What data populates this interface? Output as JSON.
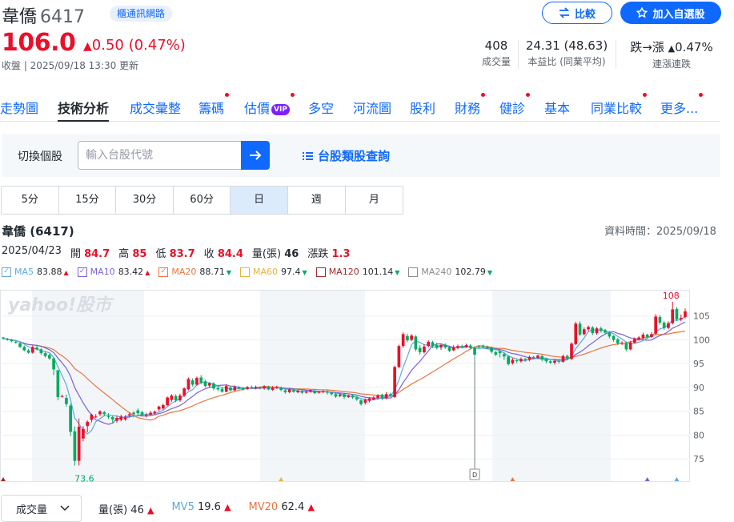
{
  "stock": {
    "name": "韋僑",
    "code": "6417",
    "category": "櫃通訊網路",
    "price": "106.0",
    "change": "0.50 (0.47%)",
    "status": "收盤 | 2025/09/18 13:30 更新"
  },
  "actions": {
    "compare": "比較",
    "watchlist": "加入自選股"
  },
  "stats": [
    {
      "value": "408",
      "label": "成交量"
    },
    {
      "value": "24.31 (48.63)",
      "label": "本益比 (同業平均)"
    },
    {
      "value_prefix": "跌→漲",
      "value_change": "0.47%",
      "label": "連漲連跌"
    }
  ],
  "nav": [
    {
      "label": "走勢圖",
      "dot": false
    },
    {
      "label": "技術分析",
      "dot": false,
      "active": true
    },
    {
      "label": "成交彙整",
      "dot": false
    },
    {
      "label": "籌碼",
      "dot": true
    },
    {
      "label": "估價",
      "dot": true,
      "vip": "VIP"
    },
    {
      "label": "多空",
      "dot": false
    },
    {
      "label": "河流圖",
      "dot": false
    },
    {
      "label": "股利",
      "dot": false
    },
    {
      "label": "財務",
      "dot": true
    },
    {
      "label": "健診",
      "dot": true
    },
    {
      "label": "基本",
      "dot": false
    },
    {
      "label": "同業比較",
      "dot": true
    },
    {
      "label": "更多...",
      "dot": true
    }
  ],
  "search": {
    "label": "切換個股",
    "placeholder": "輸入台股代號",
    "category_link": "台股類股查詢"
  },
  "periods": [
    "5分",
    "15分",
    "30分",
    "60分",
    "日",
    "週",
    "月"
  ],
  "active_period": "日",
  "chart_header": {
    "title": "韋僑 (6417)",
    "data_time": "資料時間：2025/09/18",
    "date": "2025/04/23",
    "open_label": "開",
    "open": "84.7",
    "high_label": "高",
    "high": "85",
    "low_label": "低",
    "low": "83.7",
    "close_label": "收",
    "close": "84.4",
    "volume_label": "量(張)",
    "volume": "46",
    "change_label": "漲跌",
    "change_value": "1.3"
  },
  "ma_legend": [
    {
      "name": "MA5",
      "value": "83.88",
      "dir": "up",
      "color": "#5fa9db",
      "checked": true
    },
    {
      "name": "MA10",
      "value": "83.42",
      "dir": "up",
      "color": "#7b61d1",
      "checked": true
    },
    {
      "name": "MA20",
      "value": "88.71",
      "dir": "down",
      "color": "#e8763f",
      "checked": true
    },
    {
      "name": "MA60",
      "value": "97.4",
      "dir": "down",
      "color": "#e5b43c",
      "checked": false
    },
    {
      "name": "MA120",
      "value": "101.14",
      "dir": "down",
      "color": "#9e2b2b",
      "checked": false
    },
    {
      "name": "MA240",
      "value": "102.79",
      "dir": "down",
      "color": "#8a8a8a",
      "checked": false
    }
  ],
  "chart_data": {
    "type": "candlestick",
    "watermark": "yahoo!股市",
    "y_ticks": [
      105,
      100,
      95,
      90,
      85,
      80,
      75
    ],
    "ylim": [
      70.5,
      110.5
    ],
    "max_label": "108",
    "min_label": "73.6",
    "marker_label": "D",
    "candles": [
      [
        100.5,
        100.3,
        100.6,
        100.1
      ],
      [
        100.2,
        100.0,
        100.4,
        99.8
      ],
      [
        100.0,
        99.7,
        100.2,
        99.5
      ],
      [
        99.6,
        99.4,
        99.8,
        99.2
      ],
      [
        99.3,
        98.5,
        99.5,
        98.3
      ],
      [
        98.5,
        97.8,
        98.8,
        97.6
      ],
      [
        97.8,
        97.3,
        98.1,
        97.1
      ],
      [
        97.3,
        98.5,
        98.8,
        97.1
      ],
      [
        98.4,
        98.0,
        98.7,
        97.8
      ],
      [
        98.0,
        97.2,
        98.3,
        96.9
      ],
      [
        97.2,
        96.6,
        97.6,
        96.3
      ],
      [
        96.8,
        96.1,
        97.1,
        95.8
      ],
      [
        96.1,
        93.8,
        96.3,
        92.6
      ],
      [
        93.6,
        88.0,
        93.7,
        87.3
      ],
      [
        88.1,
        88.2,
        88.5,
        87.9
      ],
      [
        87.8,
        86.5,
        88.5,
        86.0
      ],
      [
        86.2,
        80.7,
        86.6,
        79.8
      ],
      [
        80.8,
        74.6,
        81.8,
        73.6
      ],
      [
        74.6,
        81.8,
        83.5,
        73.6
      ],
      [
        79.3,
        81.3,
        81.9,
        78.7
      ],
      [
        81.9,
        82.8,
        83.1,
        80.6
      ],
      [
        83.2,
        84.3,
        84.5,
        82.7
      ],
      [
        83.8,
        83.9,
        84.4,
        83.6
      ],
      [
        84.4,
        85.0,
        85.2,
        84.0
      ],
      [
        84.8,
        84.4,
        85.1,
        84.0
      ],
      [
        84.0,
        83.8,
        84.6,
        83.4
      ],
      [
        83.8,
        83.3,
        84.1,
        82.4
      ],
      [
        83.0,
        83.6,
        84.1,
        82.6
      ],
      [
        83.2,
        83.9,
        84.3,
        82.9
      ],
      [
        83.3,
        83.7,
        84.2,
        83.0
      ],
      [
        84.2,
        84.4,
        84.8,
        83.7
      ],
      [
        84.7,
        84.4,
        85.0,
        83.7
      ],
      [
        85.2,
        84.6,
        85.6,
        84.2
      ],
      [
        84.8,
        84.2,
        85.1,
        83.9
      ],
      [
        84.0,
        84.2,
        84.7,
        83.7
      ],
      [
        84.3,
        84.7,
        85.1,
        84.0
      ],
      [
        84.6,
        84.9,
        85.2,
        84.2
      ],
      [
        85.4,
        86.0,
        86.2,
        85.0
      ],
      [
        85.6,
        86.3,
        86.6,
        85.3
      ],
      [
        86.3,
        87.9,
        88.1,
        86.1
      ],
      [
        87.4,
        88.3,
        88.6,
        87.0
      ],
      [
        88.2,
        87.3,
        88.6,
        86.9
      ],
      [
        87.3,
        88.3,
        88.7,
        87.0
      ],
      [
        88.3,
        89.8,
        90.0,
        88.0
      ],
      [
        89.6,
        91.8,
        92.1,
        89.4
      ],
      [
        91.5,
        90.6,
        91.9,
        90.2
      ],
      [
        90.6,
        92.0,
        92.3,
        90.4
      ],
      [
        92.1,
        91.0,
        92.6,
        90.7
      ],
      [
        91.3,
        90.3,
        91.6,
        90.0
      ],
      [
        90.4,
        90.9,
        91.1,
        89.9
      ],
      [
        90.8,
        89.8,
        91.1,
        89.4
      ],
      [
        89.9,
        89.6,
        90.4,
        89.2
      ],
      [
        89.7,
        89.1,
        90.1,
        88.9
      ],
      [
        89.1,
        90.3,
        90.7,
        89.0
      ],
      [
        90.0,
        89.4,
        90.3,
        89.1
      ],
      [
        89.4,
        90.1,
        90.4,
        89.2
      ],
      [
        90.0,
        89.8,
        90.3,
        89.6
      ],
      [
        89.8,
        89.6,
        90.1,
        89.3
      ],
      [
        89.7,
        90.1,
        90.3,
        89.5
      ],
      [
        90.1,
        89.9,
        90.4,
        89.7
      ],
      [
        89.8,
        90.1,
        90.4,
        89.6
      ],
      [
        90.0,
        89.9,
        90.2,
        89.6
      ],
      [
        89.8,
        90.2,
        90.5,
        89.5
      ],
      [
        90.2,
        89.6,
        90.4,
        89.4
      ],
      [
        89.5,
        89.9,
        90.3,
        89.3
      ],
      [
        89.9,
        90.1,
        90.4,
        89.7
      ],
      [
        89.9,
        89.5,
        90.2,
        89.2
      ],
      [
        89.4,
        89.0,
        89.6,
        88.7
      ],
      [
        89.0,
        89.6,
        89.9,
        88.8
      ],
      [
        89.5,
        89.1,
        89.8,
        88.9
      ],
      [
        89.0,
        89.3,
        89.5,
        88.8
      ],
      [
        89.2,
        88.9,
        89.5,
        88.6
      ],
      [
        88.9,
        89.1,
        89.3,
        88.7
      ],
      [
        89.1,
        89.4,
        89.6,
        88.9
      ],
      [
        89.3,
        88.8,
        89.5,
        88.6
      ],
      [
        88.9,
        89.1,
        89.3,
        88.7
      ],
      [
        89.0,
        89.2,
        89.4,
        88.8
      ],
      [
        89.1,
        88.9,
        89.4,
        88.5
      ],
      [
        88.9,
        88.6,
        89.1,
        88.3
      ],
      [
        88.6,
        88.1,
        88.9,
        87.8
      ],
      [
        88.2,
        88.5,
        88.8,
        88.0
      ],
      [
        88.6,
        88.0,
        88.8,
        87.6
      ],
      [
        88.0,
        88.3,
        88.5,
        87.8
      ],
      [
        88.3,
        87.9,
        88.6,
        87.6
      ],
      [
        87.9,
        87.5,
        88.2,
        87.2
      ],
      [
        87.3,
        86.5,
        87.5,
        86.2
      ],
      [
        86.8,
        87.4,
        87.7,
        86.4
      ],
      [
        87.2,
        87.7,
        88.0,
        86.9
      ],
      [
        87.5,
        87.9,
        88.2,
        87.3
      ],
      [
        87.9,
        88.3,
        88.6,
        87.6
      ],
      [
        88.5,
        87.8,
        88.7,
        87.3
      ],
      [
        87.8,
        88.6,
        89.0,
        87.5
      ],
      [
        88.6,
        88.3,
        88.9,
        88.0
      ],
      [
        88.0,
        94.3,
        94.6,
        87.8
      ],
      [
        94.3,
        98.7,
        99.0,
        94.0
      ],
      [
        98.7,
        101.2,
        101.6,
        98.3
      ],
      [
        100.8,
        99.9,
        101.3,
        99.5
      ],
      [
        100.0,
        100.9,
        101.2,
        99.7
      ],
      [
        100.7,
        98.0,
        101.0,
        97.6
      ],
      [
        98.3,
        97.4,
        98.9,
        96.9
      ],
      [
        97.4,
        98.6,
        99.1,
        97.1
      ],
      [
        98.7,
        99.6,
        99.9,
        98.4
      ],
      [
        99.5,
        98.7,
        99.8,
        98.3
      ],
      [
        98.9,
        98.3,
        99.4,
        98.0
      ],
      [
        98.4,
        98.9,
        99.2,
        97.9
      ],
      [
        99.0,
        98.4,
        99.3,
        98.1
      ],
      [
        98.4,
        97.7,
        98.6,
        97.4
      ],
      [
        97.8,
        98.4,
        98.9,
        97.6
      ],
      [
        98.3,
        98.7,
        99.0,
        98.0
      ],
      [
        98.7,
        98.5,
        99.0,
        98.2
      ],
      [
        98.5,
        98.9,
        99.2,
        98.3
      ],
      [
        98.8,
        98.3,
        99.1,
        98.0
      ],
      [
        98.3,
        96.9,
        98.6,
        96.5
      ],
      [
        98.8,
        98.6,
        98.9,
        98.1
      ],
      [
        98.8,
        98.5,
        99.0,
        98.2
      ],
      [
        98.5,
        98.3,
        98.8,
        98.0
      ],
      [
        98.3,
        97.5,
        98.6,
        97.1
      ],
      [
        97.4,
        96.9,
        97.7,
        96.6
      ],
      [
        97.6,
        97.2,
        97.9,
        96.3
      ],
      [
        97.0,
        96.5,
        97.3,
        95.8
      ],
      [
        96.5,
        94.9,
        96.8,
        94.6
      ],
      [
        95.1,
        95.8,
        96.2,
        94.8
      ],
      [
        95.7,
        95.6,
        95.9,
        95.1
      ],
      [
        95.5,
        96.0,
        96.3,
        95.2
      ],
      [
        96.0,
        95.8,
        96.2,
        95.4
      ],
      [
        95.8,
        96.4,
        96.7,
        95.5
      ],
      [
        96.4,
        96.2,
        96.6,
        95.9
      ],
      [
        96.2,
        96.7,
        96.9,
        96.0
      ],
      [
        96.6,
        95.9,
        96.8,
        95.5
      ],
      [
        95.9,
        95.5,
        96.2,
        95.1
      ],
      [
        95.5,
        95.2,
        95.8,
        94.9
      ],
      [
        95.2,
        95.6,
        95.9,
        94.8
      ],
      [
        95.6,
        95.4,
        95.8,
        95.0
      ],
      [
        95.4,
        96.6,
        96.9,
        95.2
      ],
      [
        96.6,
        96.1,
        96.9,
        95.8
      ],
      [
        96.0,
        99.2,
        99.5,
        95.8
      ],
      [
        99.1,
        103.4,
        103.8,
        98.9
      ],
      [
        103.4,
        101.1,
        103.9,
        100.8
      ],
      [
        101.2,
        102.2,
        102.6,
        100.9
      ],
      [
        102.2,
        102.7,
        103.0,
        101.8
      ],
      [
        102.6,
        101.4,
        102.9,
        101.0
      ],
      [
        101.4,
        102.4,
        102.7,
        101.1
      ],
      [
        102.4,
        101.9,
        102.8,
        101.5
      ],
      [
        102.0,
        101.5,
        102.3,
        101.1
      ],
      [
        101.5,
        100.7,
        101.8,
        100.3
      ],
      [
        100.8,
        100.0,
        101.0,
        99.6
      ],
      [
        100.1,
        99.3,
        100.4,
        98.9
      ],
      [
        99.2,
        99.4,
        99.7,
        98.9
      ],
      [
        99.3,
        98.0,
        99.6,
        97.6
      ],
      [
        98.0,
        99.4,
        99.8,
        97.8
      ],
      [
        99.4,
        100.2,
        100.5,
        99.2
      ],
      [
        100.1,
        100.5,
        100.8,
        99.8
      ],
      [
        100.4,
        101.1,
        101.5,
        100.1
      ],
      [
        101.1,
        100.6,
        101.3,
        100.3
      ],
      [
        100.6,
        101.2,
        101.6,
        100.4
      ],
      [
        101.3,
        104.9,
        105.4,
        101.0
      ],
      [
        104.8,
        103.6,
        105.2,
        103.2
      ],
      [
        103.6,
        102.5,
        104.0,
        102.1
      ],
      [
        102.5,
        103.5,
        103.9,
        102.2
      ],
      [
        103.5,
        106.4,
        108.0,
        103.2
      ],
      [
        106.5,
        104.3,
        106.9,
        104.0
      ],
      [
        104.3,
        104.6,
        105.3,
        103.9
      ],
      [
        104.8,
        106.0,
        106.6,
        104.5
      ]
    ],
    "ma5_color": "#5fa9db",
    "ma10_color": "#7b61d1",
    "ma20_color": "#e8763f",
    "up_color": "#eb0f29",
    "down_color": "#00ab5e",
    "event_markers": [
      {
        "index": 0,
        "color": "#9e2b2b"
      },
      {
        "index": 66,
        "color": "#e5b43c"
      },
      {
        "index": 121,
        "color": "#e8763f"
      },
      {
        "index": 153,
        "color": "#7b61d1"
      },
      {
        "index": 160,
        "color": "#5fa9db"
      }
    ]
  },
  "volume_row": {
    "select_label": "成交量",
    "vol_label": "量(張)",
    "vol_value": "46",
    "mv5_label": "MV5",
    "mv5_value": "19.6",
    "mv20_label": "MV20",
    "mv20_value": "62.4"
  }
}
